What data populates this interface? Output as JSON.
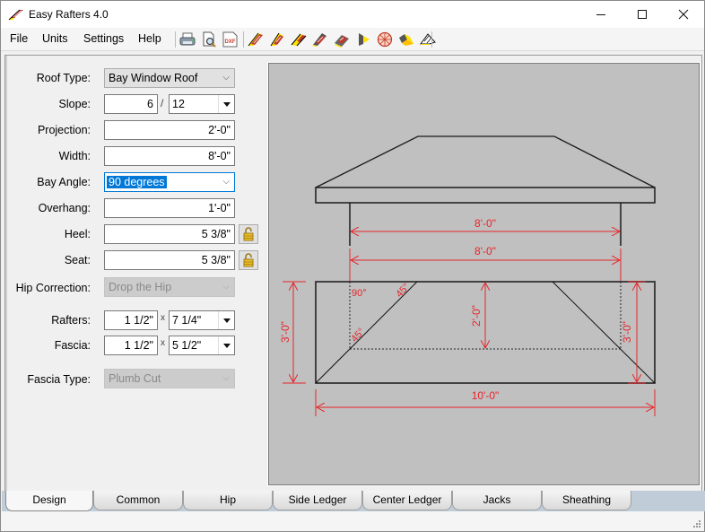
{
  "window": {
    "title": "Easy Rafters 4.0",
    "controls": {
      "minimize": "—",
      "maximize": "☐",
      "close": "✕"
    }
  },
  "menu": {
    "items": [
      "File",
      "Units",
      "Settings",
      "Help"
    ]
  },
  "toolbar": {
    "buttons": [
      {
        "name": "print",
        "icon": "printer-icon"
      },
      {
        "name": "print-preview",
        "icon": "print-preview-icon"
      },
      {
        "name": "export-dxf",
        "icon": "dxf-icon",
        "label": "DXF"
      },
      {
        "name": "common-rafter",
        "icon": "common-rafter-icon"
      },
      {
        "name": "hip-rafter",
        "icon": "hip-rafter-icon"
      },
      {
        "name": "gable-roof",
        "icon": "gable-roof-icon"
      },
      {
        "name": "hip-roof",
        "icon": "hip-roof-icon"
      },
      {
        "name": "valley-roof",
        "icon": "valley-roof-icon"
      },
      {
        "name": "shed-roof",
        "icon": "shed-roof-icon"
      },
      {
        "name": "octagon-roof",
        "icon": "octagon-roof-icon"
      },
      {
        "name": "bay-window-roof",
        "icon": "bay-window-roof-icon"
      },
      {
        "name": "dormer-roof",
        "icon": "dormer-roof-icon"
      }
    ]
  },
  "form": {
    "roof_type": {
      "label": "Roof Type:",
      "value": "Bay Window Roof"
    },
    "slope": {
      "label": "Slope:",
      "rise": "6",
      "separator": "/",
      "run": "12"
    },
    "projection": {
      "label": "Projection:",
      "value": "2'-0\""
    },
    "width": {
      "label": "Width:",
      "value": "8'-0\""
    },
    "bay_angle": {
      "label": "Bay Angle:",
      "value": "90 degrees"
    },
    "overhang": {
      "label": "Overhang:",
      "value": "1'-0\""
    },
    "heel": {
      "label": "Heel:",
      "value": "5 3/8\"",
      "locked": false
    },
    "seat": {
      "label": "Seat:",
      "value": "5 3/8\"",
      "locked": false
    },
    "hip_correction": {
      "label": "Hip Correction:",
      "value": "Drop the Hip",
      "disabled": true
    },
    "rafters": {
      "label": "Rafters:",
      "thickness": "1 1/2\"",
      "separator": "x",
      "depth": "7 1/4\""
    },
    "fascia": {
      "label": "Fascia:",
      "thickness": "1 1/2\"",
      "separator": "x",
      "depth": "5 1/2\""
    },
    "fascia_type": {
      "label": "Fascia Type:",
      "value": "Plumb Cut",
      "disabled": true
    }
  },
  "drawing": {
    "elevation_dims": [
      "8'-0\"",
      "8'-0\""
    ],
    "plan_dims": {
      "overall_width": "10'-0\"",
      "left_depth": "3'-0\"",
      "right_depth": "3'-0\"",
      "projection": "2'-0\""
    },
    "angle_labels": [
      "90°",
      "45°",
      "45°"
    ],
    "colors": {
      "dimension": "#e8242a",
      "line": "#1a1a1a",
      "background": "#c0c0c0"
    }
  },
  "tabs": {
    "active": "Design",
    "items": [
      "Design",
      "Common",
      "Hip",
      "Side Ledger",
      "Center Ledger",
      "Jacks",
      "Sheathing"
    ]
  }
}
